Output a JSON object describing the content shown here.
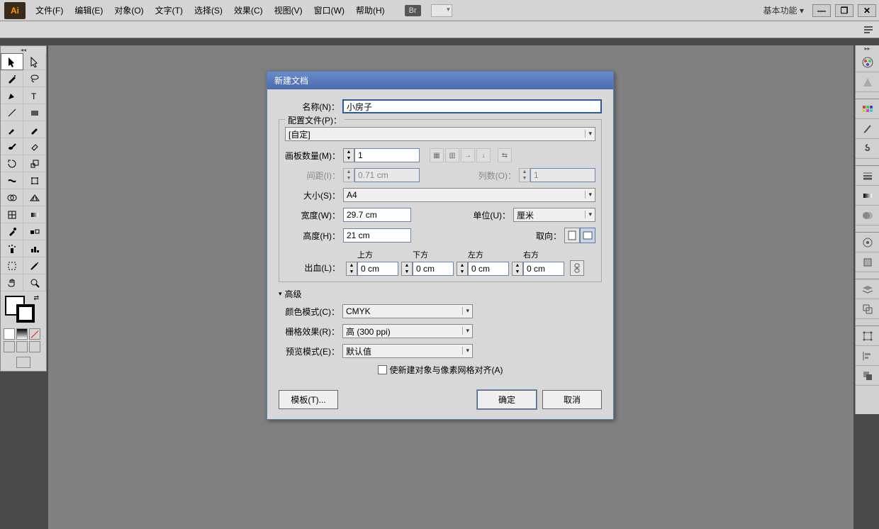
{
  "app": {
    "logo": "Ai"
  },
  "menu": [
    "文件(F)",
    "编辑(E)",
    "对象(O)",
    "文字(T)",
    "选择(S)",
    "效果(C)",
    "视图(V)",
    "窗口(W)",
    "帮助(H)"
  ],
  "topbar": {
    "br": "Br",
    "workspace": "基本功能"
  },
  "dialog": {
    "title": "新建文档",
    "name_label": "名称(N)：",
    "name_value": "小房子",
    "profile_label": "配置文件(P)：",
    "profile_value": "[自定]",
    "artboards_label": "画板数量(M)：",
    "artboards_value": "1",
    "spacing_label": "间距(I)：",
    "spacing_value": "0.71 cm",
    "cols_label": "列数(O)：",
    "cols_value": "1",
    "size_label": "大小(S)：",
    "size_value": "A4",
    "width_label": "宽度(W)：",
    "width_value": "29.7 cm",
    "units_label": "单位(U)：",
    "units_value": "厘米",
    "height_label": "高度(H)：",
    "height_value": "21 cm",
    "orient_label": "取向：",
    "bleed_label": "出血(L)：",
    "bleed_hdr": {
      "top": "上方",
      "bottom": "下方",
      "left": "左方",
      "right": "右方"
    },
    "bleed_val": {
      "top": "0 cm",
      "bottom": "0 cm",
      "left": "0 cm",
      "right": "0 cm"
    },
    "advanced": "高级",
    "colormode_label": "颜色模式(C)：",
    "colormode_value": "CMYK",
    "raster_label": "栅格效果(R)：",
    "raster_value": "高 (300 ppi)",
    "preview_label": "预览模式(E)：",
    "preview_value": "默认值",
    "align_label": "使新建对象与像素网格对齐(A)",
    "template_btn": "模板(T)...",
    "ok_btn": "确定",
    "cancel_btn": "取消"
  }
}
